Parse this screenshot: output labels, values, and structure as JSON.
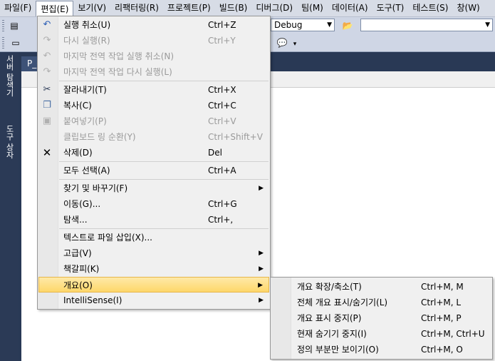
{
  "menubar": [
    "파일(F)",
    "편집(E)",
    "보기(V)",
    "리팩터링(R)",
    "프로젝트(P)",
    "빌드(B)",
    "디버그(D)",
    "팀(M)",
    "데이터(A)",
    "도구(T)",
    "테스트(S)",
    "창(W)"
  ],
  "toolbar": {
    "config_value": "Debug",
    "search_value": ""
  },
  "dock": {
    "tab1": "서버 탐색기",
    "tab2": "도구 상자"
  },
  "doc": {
    "tab_label": "P_C"
  },
  "edit_menu": [
    {
      "label": "실행 취소(U)",
      "shortcut": "Ctrl+Z",
      "icon": "undo-icon",
      "disabled": false
    },
    {
      "label": "다시 실행(R)",
      "shortcut": "Ctrl+Y",
      "icon": "redo-icon",
      "disabled": true
    },
    {
      "label": "마지막 전역 작업 실행 취소(N)",
      "shortcut": "",
      "icon": "undo-global-icon",
      "disabled": true
    },
    {
      "label": "마지막 전역 작업 다시 실행(L)",
      "shortcut": "",
      "icon": "redo-global-icon",
      "disabled": true
    },
    {
      "label": "잘라내기(T)",
      "shortcut": "Ctrl+X",
      "icon": "cut-icon",
      "disabled": false
    },
    {
      "label": "복사(C)",
      "shortcut": "Ctrl+C",
      "icon": "copy-icon",
      "disabled": false
    },
    {
      "label": "붙여넣기(P)",
      "shortcut": "Ctrl+V",
      "icon": "paste-icon",
      "disabled": true
    },
    {
      "label": "클립보드 링 순환(Y)",
      "shortcut": "Ctrl+Shift+V",
      "icon": "",
      "disabled": true
    },
    {
      "label": "삭제(D)",
      "shortcut": "Del",
      "icon": "delete-icon",
      "disabled": false
    },
    {
      "label": "모두 선택(A)",
      "shortcut": "Ctrl+A",
      "icon": "",
      "disabled": false
    },
    {
      "label": "찾기 및 바꾸기(F)",
      "shortcut": "",
      "icon": "",
      "disabled": false,
      "submenu": true
    },
    {
      "label": "이동(G)...",
      "shortcut": "Ctrl+G",
      "icon": "",
      "disabled": false
    },
    {
      "label": "탐색...",
      "shortcut": "Ctrl+,",
      "icon": "",
      "disabled": false
    },
    {
      "label": "텍스트로 파일 삽입(X)...",
      "shortcut": "",
      "icon": "",
      "disabled": false
    },
    {
      "label": "고급(V)",
      "shortcut": "",
      "icon": "",
      "disabled": false,
      "submenu": true
    },
    {
      "label": "책갈피(K)",
      "shortcut": "",
      "icon": "",
      "disabled": false,
      "submenu": true
    },
    {
      "label": "개요(O)",
      "shortcut": "",
      "icon": "",
      "disabled": false,
      "submenu": true,
      "highlighted": true
    },
    {
      "label": "IntelliSense(I)",
      "shortcut": "",
      "icon": "",
      "disabled": false,
      "submenu": true
    }
  ],
  "outline_submenu": [
    {
      "label": "개요 확장/축소(T)",
      "shortcut": "Ctrl+M, M"
    },
    {
      "label": "전체 개요 표시/숨기기(L)",
      "shortcut": "Ctrl+M, L"
    },
    {
      "label": "개요 표시 중지(P)",
      "shortcut": "Ctrl+M, P"
    },
    {
      "label": "현재 숨기기 중지(I)",
      "shortcut": "Ctrl+M, Ctrl+U"
    },
    {
      "label": "정의 부분만 보이기(O)",
      "shortcut": "Ctrl+M, O"
    }
  ],
  "colors": {
    "menubar": "#d7dce6",
    "dock": "#2b3a56",
    "highlight": "#fdd76a"
  }
}
